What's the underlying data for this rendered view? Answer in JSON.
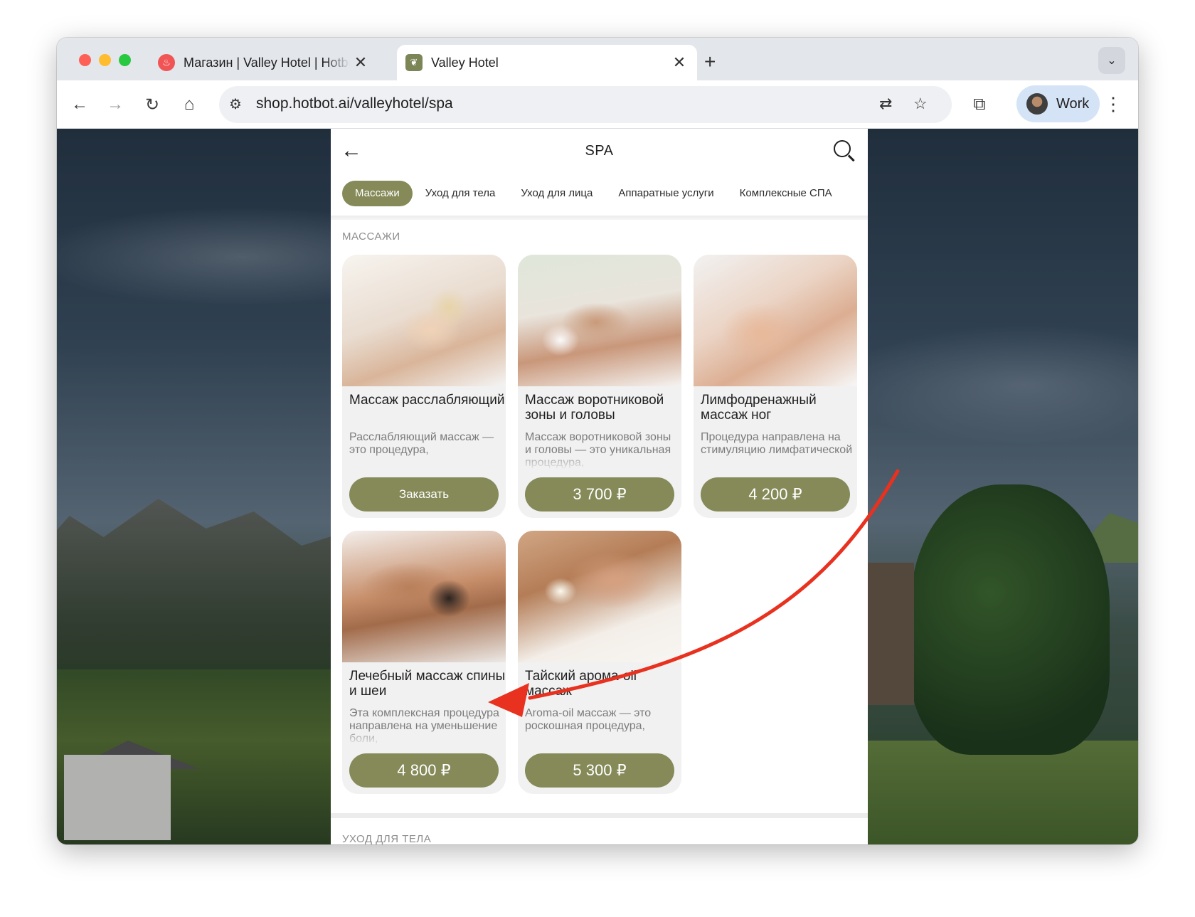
{
  "browser": {
    "tabs": [
      {
        "title": "Магазин | Valley Hotel | Hotbot",
        "active": false
      },
      {
        "title": "Valley Hotel",
        "active": true
      }
    ],
    "new_tab_label": "+",
    "url": "shop.hotbot.ai/valleyhotel/spa",
    "profile_name": "Work"
  },
  "app": {
    "title": "SPA",
    "categories": [
      "Массажи",
      "Уход для тела",
      "Уход для лица",
      "Аппаратные услуги",
      "Комплексные СПА"
    ],
    "active_category": "Массажи",
    "section_title": "МАССАЖИ",
    "next_section_title": "УХОД ДЛЯ ТЕЛА",
    "products": [
      {
        "name": "Массаж расслабляющий",
        "desc": "Расслабляющий массаж — это процедура,",
        "button": "Заказать"
      },
      {
        "name": "Массаж воротниковой зоны и головы",
        "desc": "Массаж воротниковой зоны и головы — это уникальная процедура,",
        "button": "3 700 ₽"
      },
      {
        "name": "Лимфодренажный массаж ног",
        "desc": "Процедура направлена на стимуляцию лимфатической",
        "button": "4 200 ₽"
      },
      {
        "name": "Лечебный массаж спины и шеи",
        "desc": "Эта комплексная процедура направлена на уменьшение боли,",
        "button": "4 800 ₽"
      },
      {
        "name": "Тайский арома-oil массаж",
        "desc": "Aroma-oil массаж — это роскошная процедура,",
        "button": "5 300 ₽"
      }
    ]
  },
  "annotation": {
    "arrow_color": "#e8311f"
  },
  "colors": {
    "accent": "#858a58"
  }
}
